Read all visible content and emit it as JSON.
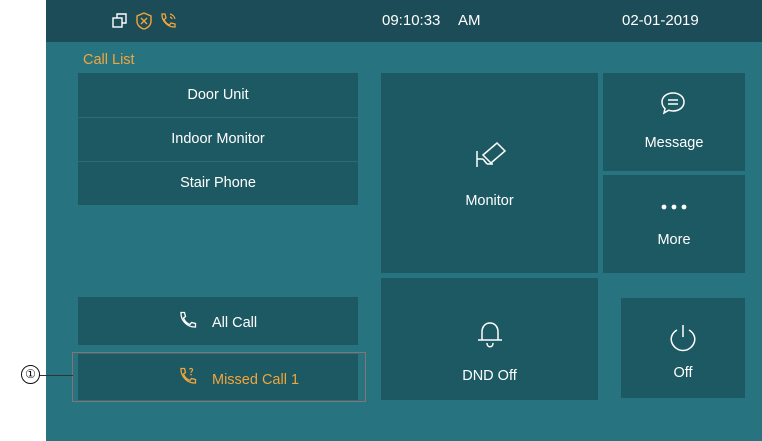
{
  "status_bar": {
    "icons": [
      "windows-icon",
      "shield-x-icon",
      "phone-ringing-icon"
    ],
    "time": "09:10:33",
    "ampm": "AM",
    "date": "02-01-2019"
  },
  "call_list": {
    "title": "Call List",
    "items": [
      {
        "label": "Door Unit"
      },
      {
        "label": "Indoor Monitor"
      },
      {
        "label": "Stair Phone"
      }
    ]
  },
  "buttons": {
    "all_call": "All Call",
    "missed_call": "Missed Call 1",
    "monitor": "Monitor",
    "message": "Message",
    "more": "More",
    "dnd": "DND Off",
    "off": "Off"
  },
  "callout": {
    "number": "①"
  },
  "colors": {
    "background": "#277480",
    "status_bar": "#1c4c58",
    "tile": "#1d5962",
    "accent": "#f2a53c",
    "text": "#ffffff"
  }
}
